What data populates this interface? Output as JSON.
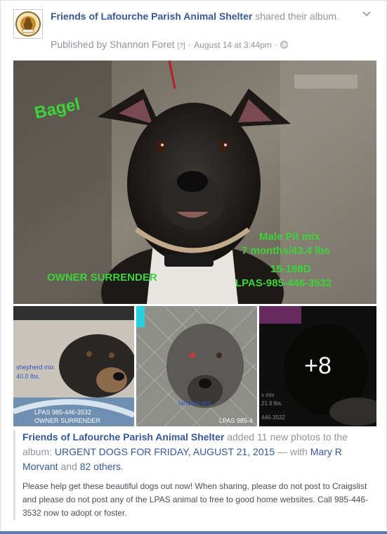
{
  "post": {
    "page_name": "Friends of Lafourche Parish Animal Shelter",
    "action_text": "shared their album.",
    "published_prefix": "Published by",
    "publisher": "Shannon Foret",
    "help_mark": "[?]",
    "separator": "·",
    "timestamp": "August 14 at 3:44pm",
    "audience_icon": "globe-icon",
    "menu_icon": "chevron-down-icon"
  },
  "main_photo": {
    "name_label": "Bagel",
    "line1": "Male Pit mix",
    "line2": "7 months/43.4 lbs",
    "line3": "15-188D",
    "line4": "LPAS-985-446-3532",
    "status": "OWNER SURRENDER"
  },
  "thumbs": [
    {
      "line1": "LPAS 985-446-3532",
      "line2": "OWNER SURRENDER",
      "side_text": "shepherd mix",
      "side_text2": "40.0 lbs."
    },
    {
      "side_text": "tahoula mix",
      "corner": "LPAS 985-4"
    },
    {
      "side_text": "x mix",
      "side_text2": "21.9 lbs.",
      "corner": "446-3532",
      "more": "+8"
    }
  ],
  "album": {
    "page_name": "Friends of Lafourche Parish Animal Shelter",
    "added_text": "added 11 new photos to the album:",
    "album_title": "URGENT DOGS FOR FRIDAY, AUGUST 21, 2015",
    "with_text": "— with",
    "tagged_person": "Mary R Morvant",
    "and_text": "and",
    "others": "82 others",
    "period": "."
  },
  "description": "Please help get these beautiful dogs out now! When sharing, please do not post to Craigslist and please do not post any of the LPAS animal to free to good home websites. Call 985-446-3532 now to adopt or foster."
}
